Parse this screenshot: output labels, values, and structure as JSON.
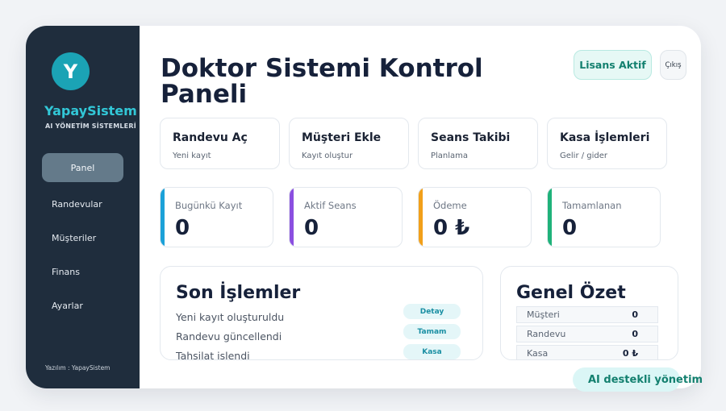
{
  "sidebar": {
    "logo_letter": "Y",
    "brand": "YapaySistem",
    "subtitle": "AI YÖNETİM SİSTEMLERİ",
    "items": [
      {
        "label": "Panel"
      },
      {
        "label": "Randevular"
      },
      {
        "label": "Müşteriler"
      },
      {
        "label": "Finans"
      },
      {
        "label": "Ayarlar"
      }
    ],
    "active_item": "Panel",
    "credit": "Yazılım : YapaySistem"
  },
  "header": {
    "title": "Doktor Sistemi Kontrol Paneli",
    "license_label": "Lisans Aktif",
    "logout_label": "Çıkış"
  },
  "actions": [
    {
      "title": "Randevu Aç",
      "subtitle": "Yeni kayıt"
    },
    {
      "title": "Müşteri Ekle",
      "subtitle": "Kayıt oluştur"
    },
    {
      "title": "Seans Takibi",
      "subtitle": "Planlama"
    },
    {
      "title": "Kasa İşlemleri",
      "subtitle": "Gelir / gider"
    }
  ],
  "stats": [
    {
      "label": "Bugünkü Kayıt",
      "value": "0",
      "accent": "#1ba1d8"
    },
    {
      "label": "Aktif Seans",
      "value": "0",
      "accent": "#8b4fe0"
    },
    {
      "label": "Ödeme",
      "value": "0 ₺",
      "accent": "#f2a01a"
    },
    {
      "label": "Tamamlanan",
      "value": "0",
      "accent": "#1fb27a"
    }
  ],
  "recent": {
    "title": "Son İşlemler",
    "rows": [
      {
        "text": "Yeni kayıt oluşturuldu",
        "tag": "Detay"
      },
      {
        "text": "Randevu güncellendi",
        "tag": "Tamam"
      },
      {
        "text": "Tahsilat işlendi",
        "tag": "Kasa"
      }
    ]
  },
  "summary": {
    "title": "Genel Özet",
    "rows": [
      {
        "key": "Müşteri",
        "value": "0"
      },
      {
        "key": "Randevu",
        "value": "0"
      },
      {
        "key": "Kasa",
        "value": "0 ₺"
      }
    ]
  },
  "footer_badge": "AI destekli yönetim",
  "colors": {
    "sidebar_bg": "#1f2d3d",
    "brand": "#32c7d7",
    "accent_teal": "#1ba3b5",
    "license_text": "#13806f"
  }
}
